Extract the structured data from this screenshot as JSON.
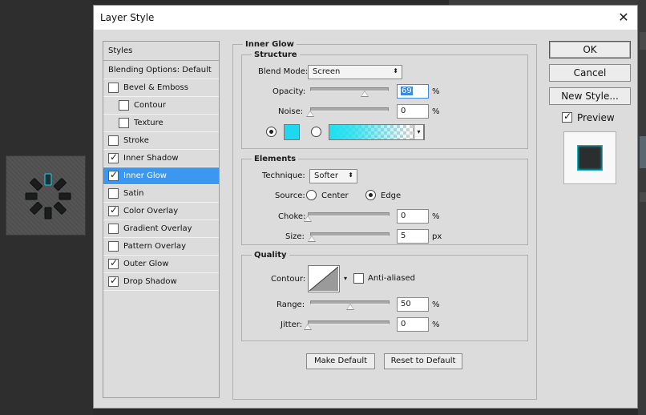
{
  "dialog": {
    "title": "Layer Style",
    "close_glyph": "✕"
  },
  "styles_list": {
    "items": [
      {
        "label": "Styles",
        "checkbox": false
      },
      {
        "label": "Blending Options: Default",
        "checkbox": false
      },
      {
        "label": "Bevel & Emboss",
        "checkbox": true,
        "checked": false
      },
      {
        "label": "Contour",
        "checkbox": true,
        "checked": false,
        "indent": true
      },
      {
        "label": "Texture",
        "checkbox": true,
        "checked": false,
        "indent": true
      },
      {
        "label": "Stroke",
        "checkbox": true,
        "checked": false
      },
      {
        "label": "Inner Shadow",
        "checkbox": true,
        "checked": true
      },
      {
        "label": "Inner Glow",
        "checkbox": true,
        "checked": true,
        "selected": true
      },
      {
        "label": "Satin",
        "checkbox": true,
        "checked": false
      },
      {
        "label": "Color Overlay",
        "checkbox": true,
        "checked": true
      },
      {
        "label": "Gradient Overlay",
        "checkbox": true,
        "checked": false
      },
      {
        "label": "Pattern Overlay",
        "checkbox": true,
        "checked": false
      },
      {
        "label": "Outer Glow",
        "checkbox": true,
        "checked": true
      },
      {
        "label": "Drop Shadow",
        "checkbox": true,
        "checked": true
      }
    ]
  },
  "inner_glow": {
    "panel_title": "Inner Glow",
    "structure": {
      "title": "Structure",
      "blend_mode_label": "Blend Mode:",
      "blend_mode_value": "Screen",
      "opacity_label": "Opacity:",
      "opacity_value": "69",
      "opacity_level": 0.69,
      "noise_label": "Noise:",
      "noise_value": "0",
      "noise_level": 0,
      "percent": "%",
      "glow_color": "#1ed8f0",
      "color_mode": "solid"
    },
    "elements": {
      "title": "Elements",
      "technique_label": "Technique:",
      "technique_value": "Softer",
      "source_label": "Source:",
      "source_center": "Center",
      "source_edge": "Edge",
      "source_selected": "Edge",
      "choke_label": "Choke:",
      "choke_value": "0",
      "choke_level": 0,
      "size_label": "Size:",
      "size_value": "5",
      "size_level": 0.02,
      "percent": "%",
      "px": "px"
    },
    "quality": {
      "title": "Quality",
      "contour_label": "Contour:",
      "anti_aliased_label": "Anti-aliased",
      "anti_aliased": false,
      "range_label": "Range:",
      "range_value": "50",
      "range_level": 0.5,
      "jitter_label": "Jitter:",
      "jitter_value": "0",
      "jitter_level": 0,
      "percent": "%"
    },
    "make_default_label": "Make Default",
    "reset_default_label": "Reset to Default"
  },
  "actions": {
    "ok_label": "OK",
    "cancel_label": "Cancel",
    "new_style_label": "New Style...",
    "preview_label": "Preview",
    "preview_checked": true
  }
}
